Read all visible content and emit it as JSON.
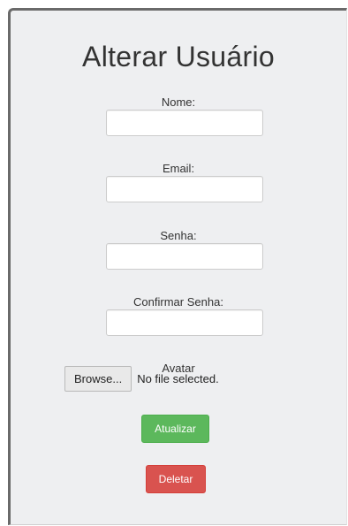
{
  "form": {
    "title": "Alterar Usuário",
    "fields": [
      {
        "label": "Nome:",
        "value": "",
        "placeholder": ""
      },
      {
        "label": "Email:",
        "value": "",
        "placeholder": ""
      },
      {
        "label": "Senha:",
        "value": "",
        "placeholder": ""
      },
      {
        "label": "Confirmar Senha:",
        "value": "",
        "placeholder": ""
      }
    ],
    "avatar": {
      "label": "Avatar",
      "browse_label": "Browse...",
      "status": "No file selected."
    },
    "update_button": "Atualizar",
    "delete_button": "Deletar"
  },
  "colors": {
    "panel_background": "#eeeff1",
    "success": "#5cb85c",
    "danger": "#d9534f"
  }
}
